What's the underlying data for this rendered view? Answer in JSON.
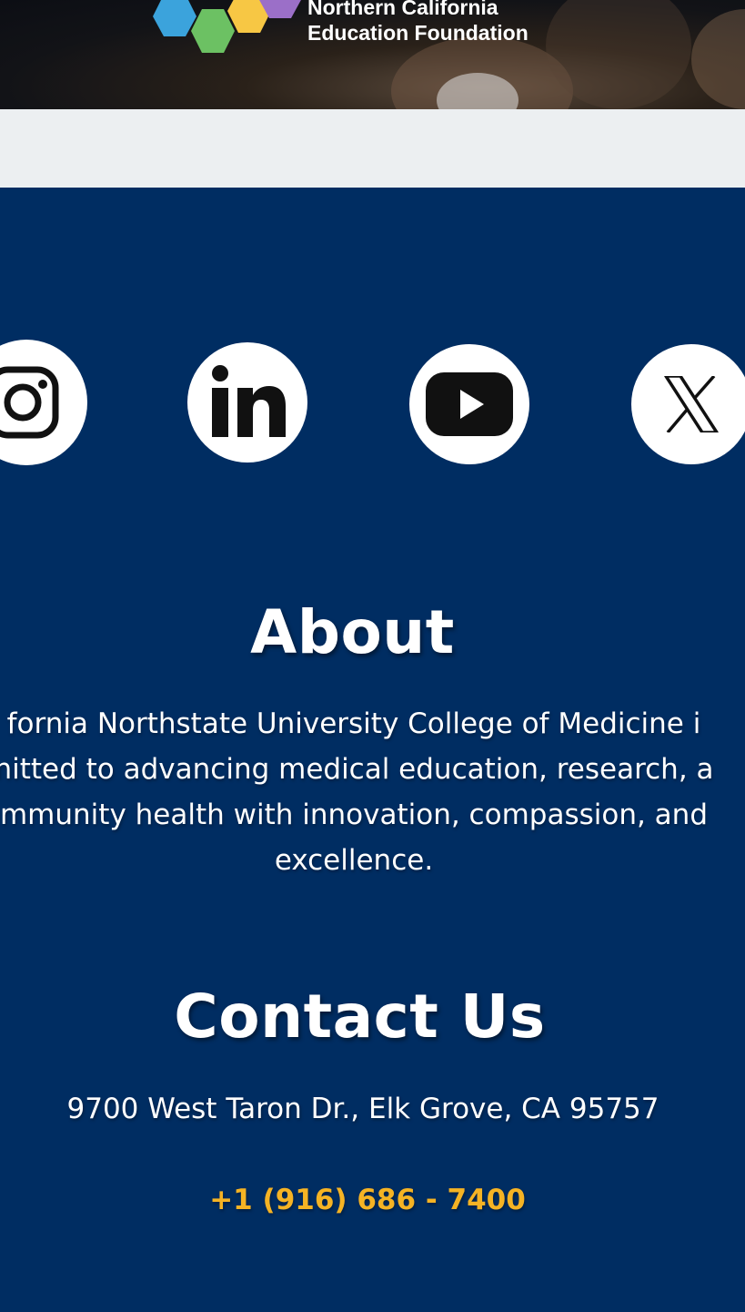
{
  "header": {
    "logo_line1": "Northern California",
    "logo_line2": "Education Foundation",
    "logo_colors": [
      "#3ba3dc",
      "#6cc163",
      "#f7c744",
      "#9b6fc8",
      "#4cb050"
    ]
  },
  "social": [
    {
      "name": "instagram",
      "icon": "instagram-icon"
    },
    {
      "name": "linkedin",
      "icon": "linkedin-icon"
    },
    {
      "name": "youtube",
      "icon": "youtube-icon"
    },
    {
      "name": "x",
      "icon": "x-icon"
    }
  ],
  "about": {
    "title": "About",
    "lines": [
      "fornia Northstate University College of Medicine i",
      "nitted to advancing medical education, research, a",
      "mmunity health with innovation, compassion, and",
      "excellence."
    ]
  },
  "contact": {
    "title": "Contact Us",
    "address": "9700 West Taron Dr., Elk Grove, CA 95757",
    "phone": "+1 (916) 686 - 7400"
  },
  "colors": {
    "background": "#002d62",
    "strip": "#eceff1",
    "phone": "#f5b324"
  }
}
